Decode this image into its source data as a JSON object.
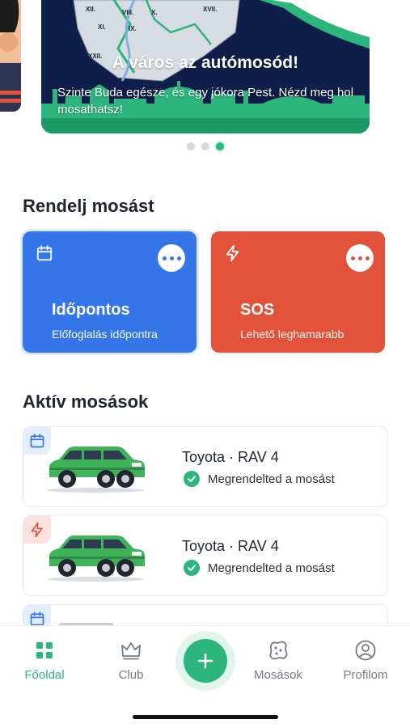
{
  "banner": {
    "title": "A város az autómosód!",
    "text": "Szinte Buda egésze, és egy jókora Pest. Nézd meg hol mosathatsz!",
    "map_districts": [
      "XII.",
      "X.",
      "XI.",
      "IX.",
      "VIII.",
      "XVII.",
      "XXII."
    ],
    "dots": 3,
    "active_dot": 2
  },
  "order": {
    "heading": "Rendelj mosást",
    "scheduled": {
      "title": "Időpontos",
      "subtitle": "Előfoglalás időpontra",
      "icon": "calendar-icon",
      "color": "#3475e8"
    },
    "sos": {
      "title": "SOS",
      "subtitle": "Lehető leghamarabb",
      "icon": "lightning-icon",
      "color": "#e2523b"
    }
  },
  "active": {
    "heading": "Aktív mosások",
    "items": [
      {
        "type": "scheduled",
        "type_icon": "calendar-icon",
        "car": "Toyota · RAV 4",
        "status": "Megrendelted a mosást"
      },
      {
        "type": "sos",
        "type_icon": "lightning-icon",
        "car": "Toyota · RAV 4",
        "status": "Megrendelted a mosást"
      }
    ]
  },
  "nav": {
    "items": [
      {
        "label": "Főoldal",
        "icon": "grid-icon",
        "active": true
      },
      {
        "label": "Club",
        "icon": "crown-icon",
        "active": false
      },
      {
        "label": "",
        "icon": "plus-icon",
        "active": false
      },
      {
        "label": "Mosások",
        "icon": "sponge-icon",
        "active": false
      },
      {
        "label": "Profilom",
        "icon": "user-icon",
        "active": false
      }
    ]
  },
  "colors": {
    "accent": "#2cb67d",
    "banner_bg": "#0f1e4a",
    "scheduled": "#3475e8",
    "sos": "#e2523b"
  }
}
